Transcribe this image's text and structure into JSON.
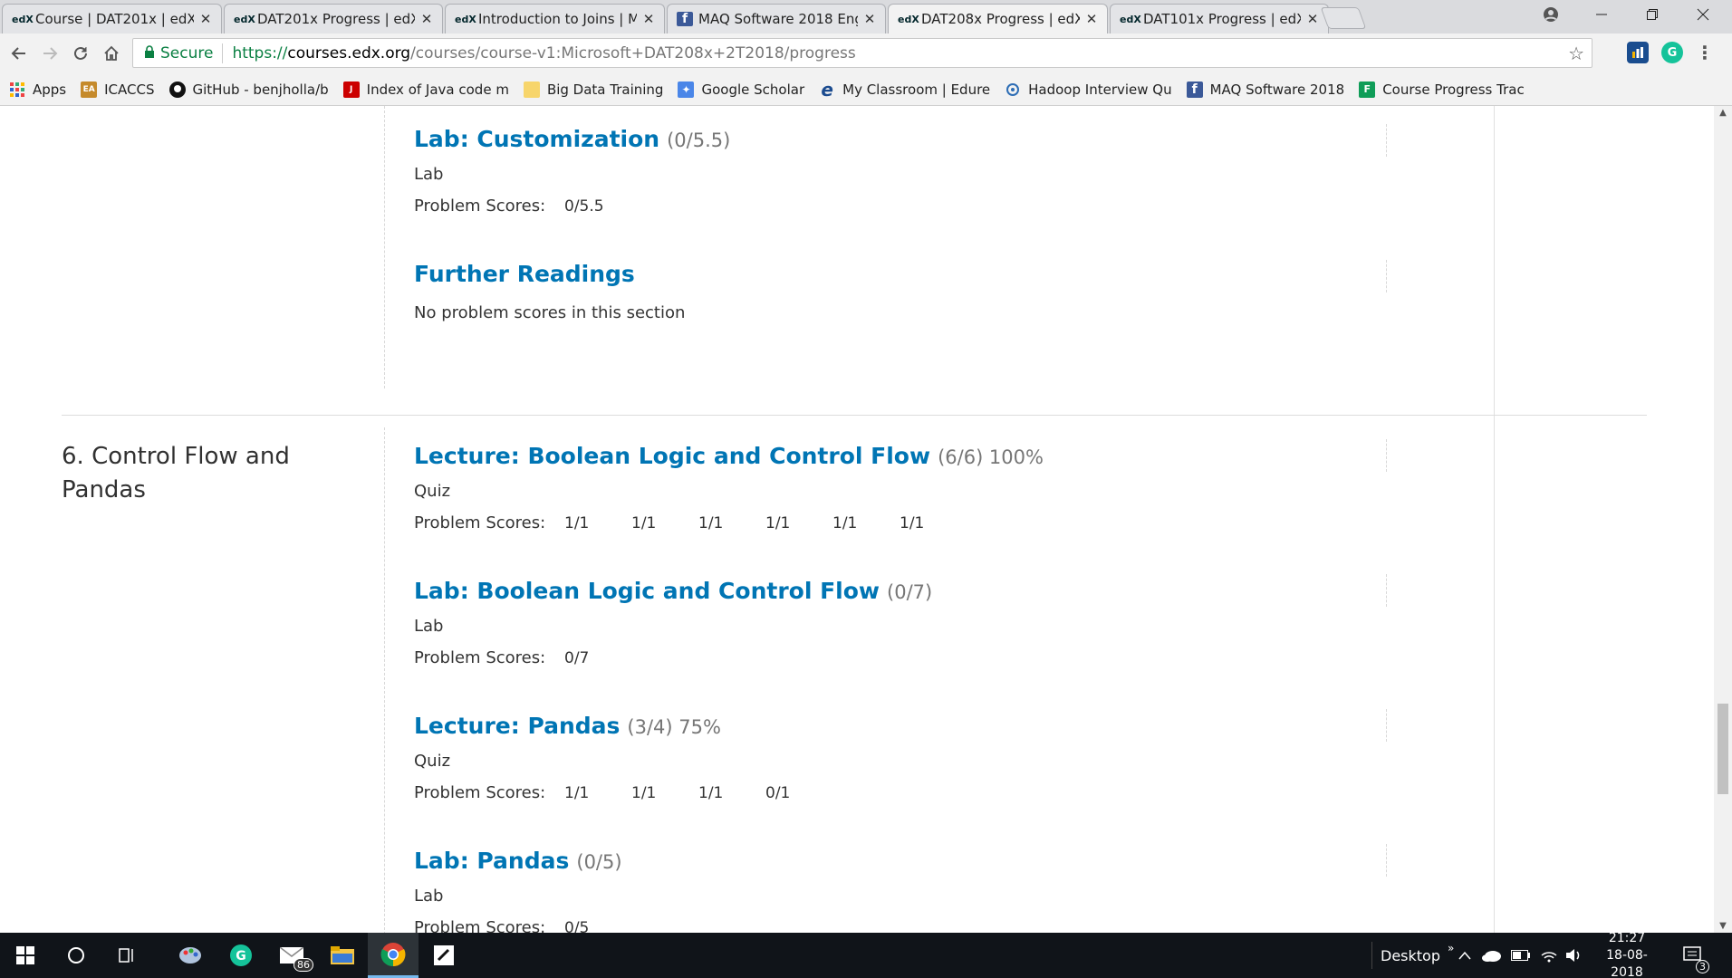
{
  "tabs": [
    {
      "label": "Course | DAT201x | edX",
      "icon": "edx-icon",
      "active": false
    },
    {
      "label": "DAT201x Progress | edX",
      "icon": "edx-icon",
      "active": false
    },
    {
      "label": "Introduction to Joins | Mc",
      "icon": "edx-icon",
      "active": false
    },
    {
      "label": "MAQ Software 2018 Engi",
      "icon": "facebook-icon",
      "active": false
    },
    {
      "label": "DAT208x Progress | edX",
      "icon": "edx-icon",
      "active": true
    },
    {
      "label": "DAT101x Progress | edX",
      "icon": "edx-icon",
      "active": false
    }
  ],
  "tab_close": "✕",
  "favicon_edx": "edX",
  "favicon_fb": "f",
  "address": {
    "secure_label": "Secure",
    "url_proto": "https://",
    "url_host": "courses.edx.org",
    "url_path": "/courses/course-v1:Microsoft+DAT208x+2T2018/progress"
  },
  "extensions": {
    "grammarly": "G"
  },
  "bookmarks": [
    {
      "label": "Apps",
      "icon": "apps-grid-icon"
    },
    {
      "label": "ICACCS",
      "icon": "icaccs-icon"
    },
    {
      "label": "GitHub - benjholla/b",
      "icon": "github-icon"
    },
    {
      "label": "Index of Java code m",
      "icon": "java-icon"
    },
    {
      "label": "Big Data Training",
      "icon": "folder-icon"
    },
    {
      "label": "Google Scholar",
      "icon": "scholar-icon"
    },
    {
      "label": "My Classroom | Edure",
      "icon": "edureka-icon"
    },
    {
      "label": "Hadoop Interview Qu",
      "icon": "hadoop-icon"
    },
    {
      "label": "MAQ Software 2018",
      "icon": "facebook-icon"
    },
    {
      "label": "Course Progress Trac",
      "icon": "forms-icon"
    }
  ],
  "content": {
    "top_sections": [
      {
        "name": "Lab: Customization",
        "score": "(0/5.5)",
        "format": "Lab",
        "problem_label": "Problem Scores:",
        "scores": [
          "0/5.5"
        ]
      },
      {
        "name": "Further Readings",
        "score": "",
        "format": "",
        "no_scores": "No problem scores in this section",
        "scores": []
      }
    ],
    "chapter": {
      "title": "6. Control Flow and Pandas",
      "sections": [
        {
          "name": "Lecture: Boolean Logic and Control Flow",
          "score": "(6/6) 100%",
          "format": "Quiz",
          "problem_label": "Problem Scores:",
          "scores": [
            "1/1",
            "1/1",
            "1/1",
            "1/1",
            "1/1",
            "1/1"
          ]
        },
        {
          "name": "Lab: Boolean Logic and Control Flow",
          "score": "(0/7)",
          "format": "Lab",
          "problem_label": "Problem Scores:",
          "scores": [
            "0/7"
          ]
        },
        {
          "name": "Lecture: Pandas",
          "score": "(3/4) 75%",
          "format": "Quiz",
          "problem_label": "Problem Scores:",
          "scores": [
            "1/1",
            "1/1",
            "1/1",
            "0/1"
          ]
        },
        {
          "name": "Lab: Pandas",
          "score": "(0/5)",
          "format": "Lab",
          "problem_label": "Problem Scores:",
          "scores": [
            "0/5"
          ]
        }
      ]
    }
  },
  "taskbar": {
    "mail_badge": "86",
    "desktop_label": "Desktop",
    "time": "21:27",
    "date": "18-08-2018",
    "notif_count": "3"
  }
}
